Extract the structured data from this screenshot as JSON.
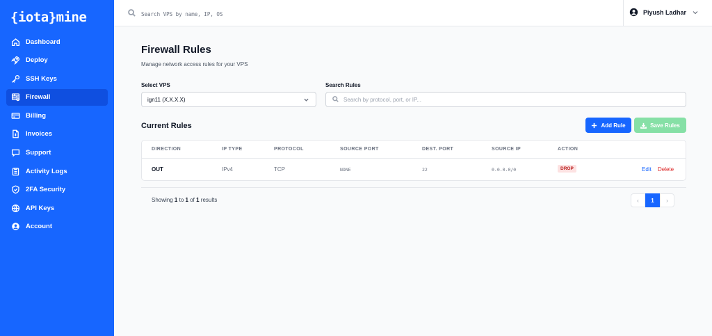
{
  "sidebar": {
    "logo": "{iota}mine",
    "items": [
      {
        "label": "Dashboard",
        "icon": "home-icon"
      },
      {
        "label": "Deploy",
        "icon": "rocket-icon"
      },
      {
        "label": "SSH Keys",
        "icon": "key-icon"
      },
      {
        "label": "Firewall",
        "icon": "firewall-icon",
        "active": true
      },
      {
        "label": "Billing",
        "icon": "credit-card-icon"
      },
      {
        "label": "Invoices",
        "icon": "document-icon"
      },
      {
        "label": "Support",
        "icon": "chat-icon"
      },
      {
        "label": "Activity Logs",
        "icon": "clipboard-icon"
      },
      {
        "label": "2FA Security",
        "icon": "shield-icon"
      },
      {
        "label": "API Keys",
        "icon": "globe-icon"
      },
      {
        "label": "Account",
        "icon": "user-circle-icon"
      }
    ]
  },
  "topbar": {
    "search_placeholder": "Search VPS by name, IP, OS",
    "user_name": "Piyush Ladhar"
  },
  "page": {
    "title": "Firewall Rules",
    "subtitle": "Manage network access rules for your VPS"
  },
  "filters": {
    "vps_label": "Select VPS",
    "vps_value": "ign11 (X.X.X.X)",
    "search_label": "Search Rules",
    "search_placeholder": "Search by protocol, port, or IP..."
  },
  "rules": {
    "title": "Current Rules",
    "add_label": "Add Rule",
    "save_label": "Save Rules",
    "columns": [
      "DIRECTION",
      "IP TYPE",
      "PROTOCOL",
      "SOURCE PORT",
      "DEST. PORT",
      "SOURCE IP",
      "ACTION"
    ],
    "rows": [
      {
        "direction": "OUT",
        "ip_type": "IPv4",
        "protocol": "TCP",
        "source_port": "NONE",
        "dest_port": "22",
        "source_ip": "0.0.0.0/0",
        "action": "DROP",
        "edit": "Edit",
        "delete": "Delete"
      }
    ]
  },
  "pagination": {
    "showing_prefix": "Showing",
    "from": "1",
    "to_word": "to",
    "to": "1",
    "of_word": "of",
    "total": "1",
    "suffix": "results",
    "current_page": "1",
    "prev": "‹",
    "next": "›"
  },
  "colors": {
    "primary": "#1766ff",
    "sidebar_active": "#0f4fe0",
    "save_button": "#86e0a6",
    "drop_badge_bg": "#fde2e2",
    "drop_badge_text": "#b91c1c",
    "delete": "#dc2626"
  }
}
